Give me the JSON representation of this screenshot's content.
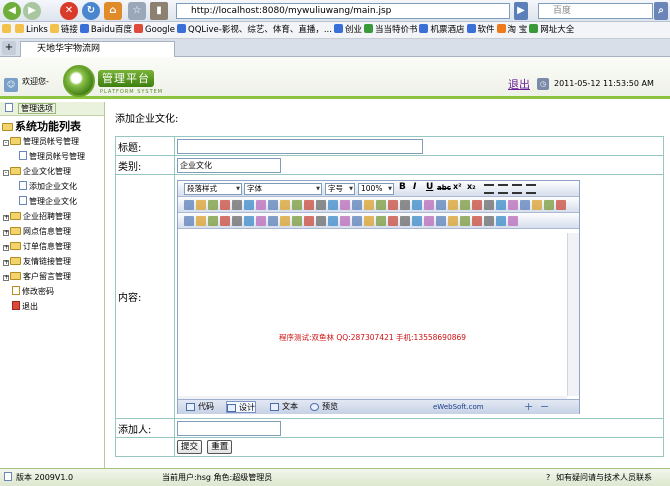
{
  "browser": {
    "address": "http://localhost:8080/mywuliuwang/main.jsp",
    "search_placeholder": "百度",
    "links": [
      {
        "label": "Links",
        "color": "#f2c24b"
      },
      {
        "label": "链接",
        "color": "#f2c24b"
      },
      {
        "label": "Baidu百度",
        "color": "#3a6fd8"
      },
      {
        "label": "Google",
        "color": "#e04a3a"
      },
      {
        "label": "QQLive-影视、综艺、体育、直播，...",
        "color": "#3a6fd8"
      },
      {
        "label": "创业",
        "color": "#3a6fd8"
      },
      {
        "label": "当当特价书",
        "color": "#3a9a3a"
      },
      {
        "label": "机票酒店",
        "color": "#3a6fd8"
      },
      {
        "label": "软件",
        "color": "#3a6fd8"
      },
      {
        "label": "淘 宝",
        "color": "#ef7a1a"
      },
      {
        "label": "网址大全",
        "color": "#3a9a3a"
      }
    ],
    "tab_title": "天地华宇物流网"
  },
  "header": {
    "welcome": "欢迎您-",
    "logo_title": "管理平台",
    "logo_sub": "PLATFORM SYSTEM",
    "exit": "退出",
    "datetime": "2011-05-12 11:53:50 AM"
  },
  "sidebar": {
    "panel_title": "管理选项",
    "tree_title": "系统功能列表",
    "items": [
      {
        "label": "管理员帐号管理",
        "level": 1,
        "type": "folder",
        "box": "-"
      },
      {
        "label": "管理员帐号管理",
        "level": 2,
        "type": "page"
      },
      {
        "label": "企业文化管理",
        "level": 1,
        "type": "folder",
        "box": "-"
      },
      {
        "label": "添加企业文化",
        "level": 2,
        "type": "page"
      },
      {
        "label": "管理企业文化",
        "level": 2,
        "type": "page"
      },
      {
        "label": "企业招聘管理",
        "level": 1,
        "type": "folder",
        "box": "+"
      },
      {
        "label": "网点信息管理",
        "level": 1,
        "type": "folder",
        "box": "+"
      },
      {
        "label": "订单信息管理",
        "level": 1,
        "type": "folder",
        "box": "+"
      },
      {
        "label": "友情链接管理",
        "level": 1,
        "type": "folder",
        "box": "+"
      },
      {
        "label": "客户留言管理",
        "level": 1,
        "type": "folder",
        "box": "+"
      },
      {
        "label": "修改密码",
        "level": 1,
        "type": "key"
      },
      {
        "label": "退出",
        "level": 1,
        "type": "exit"
      }
    ]
  },
  "main": {
    "page_title": "添加企业文化:",
    "label_title": "标题:",
    "title_value": "",
    "label_category": "类别:",
    "category_value": "企业文化",
    "label_content": "内容:",
    "label_adder": "添加人:",
    "adder_value": "",
    "submit": "提交",
    "reset": "重置"
  },
  "editor": {
    "paragraph_style": "段落样式",
    "font": "字体",
    "font_size": "字号",
    "zoom": "100%",
    "content_text": "程序测试:双鱼林 QQ:287307421 手机:13558690869",
    "modes": [
      "代码",
      "设计",
      "文本",
      "预览"
    ],
    "active_mode": "设计",
    "brand": "eWebSoft.com"
  },
  "status": {
    "version": "版本 2009V1.0",
    "current_user": "当前用户:hsg  角色:超级管理员",
    "help": "如有疑问请与技术人员联系"
  }
}
